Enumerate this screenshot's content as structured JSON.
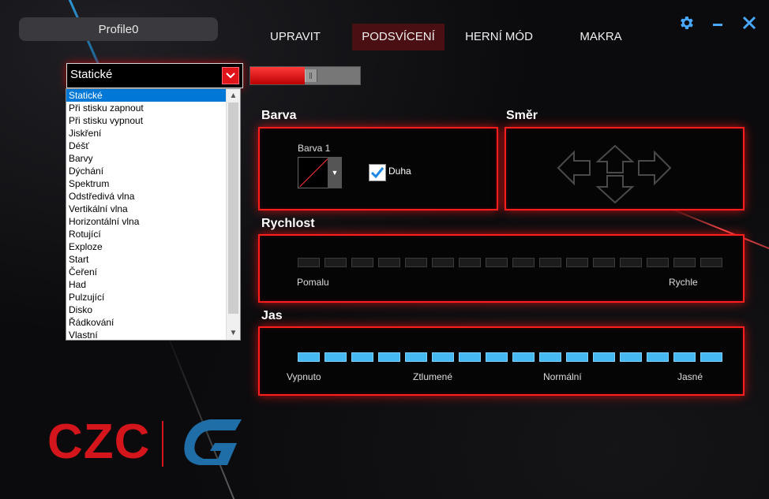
{
  "profile": {
    "name": "Profile0"
  },
  "tabs": [
    {
      "label": "UPRAVIT",
      "active": false
    },
    {
      "label": "PODSVÍCENÍ",
      "active": true
    },
    {
      "label": "HERNÍ MÓD",
      "active": false
    },
    {
      "label": "MAKRA",
      "active": false
    }
  ],
  "window_controls": {
    "settings": "gear-icon",
    "minimize": "minimize-icon",
    "close": "close-icon"
  },
  "effect": {
    "selected": "Statické",
    "options": [
      "Statické",
      "Při stisku zapnout",
      "Při stisku vypnout",
      "Jiskření",
      "Déšť",
      "Barvy",
      "Dýchání",
      "Spektrum",
      "Odstředivá vlna",
      "Vertikální vlna",
      "Horizontální vlna",
      "Rotující",
      "Exploze",
      "Start",
      "Čeření",
      "Had",
      "Pulzující",
      "Disko",
      "Řádkování",
      "Vlastní"
    ]
  },
  "lighting_toggle": {
    "on": true,
    "fill_fraction": 0.5
  },
  "color_section": {
    "title": "Barva",
    "color_label": "Barva 1",
    "rainbow_label": "Duha",
    "rainbow_checked": true
  },
  "direction_section": {
    "title": "Směr"
  },
  "speed_section": {
    "title": "Rychlost",
    "min_label": "Pomalu",
    "max_label": "Rychle",
    "steps": 16,
    "value": 0
  },
  "brightness_section": {
    "title": "Jas",
    "labels": [
      "Vypnuto",
      "Ztlumené",
      "Normální",
      "Jasné"
    ],
    "steps": 16,
    "value": 16
  },
  "colors": {
    "accent_red": "#ff1e1e",
    "active_tab": "#4a0f12",
    "bar_blue": "#46b8f2",
    "icon_blue": "#4aa8ff",
    "logo_red": "#d4161c",
    "logo_blue": "#1f6ea8"
  },
  "logo": {
    "text": "CZC"
  }
}
